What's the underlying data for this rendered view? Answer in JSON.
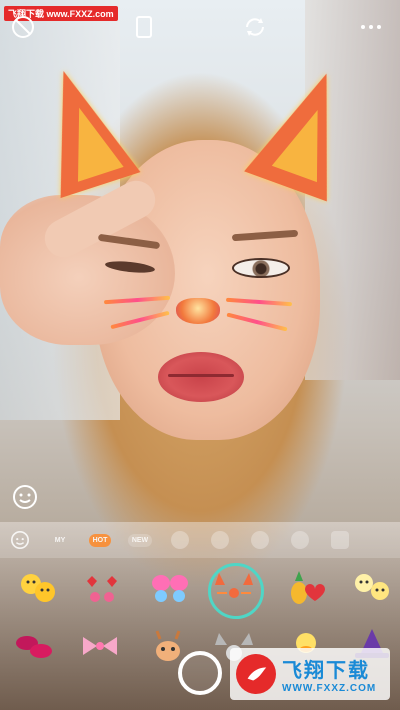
{
  "watermark_top": "飞翔下载 www.FXXZ.com",
  "watermark_bottom": {
    "title": "飞翔下载",
    "url": "WWW.FXXZ.COM"
  },
  "topbar": {
    "icons": [
      "timer-off-icon",
      "aspect-ratio-icon",
      "camera-switch-icon",
      "more-icon"
    ]
  },
  "tabs": [
    {
      "id": "favorites",
      "icon": "face-edit-icon"
    },
    {
      "id": "my",
      "label": "MY"
    },
    {
      "id": "hot",
      "label": "HOT"
    },
    {
      "id": "new",
      "label": "NEW"
    },
    {
      "id": "cat",
      "icon": "cat-face-icon"
    },
    {
      "id": "dog",
      "icon": "dog-face-icon"
    },
    {
      "id": "raccoon",
      "icon": "raccoon-icon"
    },
    {
      "id": "monster",
      "icon": "monster-icon"
    },
    {
      "id": "more",
      "icon": "more-tab-icon"
    }
  ],
  "stickers": [
    "emoji-pair-sticker",
    "red-heart-glasses-sticker",
    "butterfly-sticker",
    "sparkle-cat-sticker",
    "pineapple-heart-sticker",
    "chick-pair-sticker",
    "lips-sticker",
    "sparkle-bow-sticker",
    "deer-sticker",
    "cat-ears-sticker",
    "duck-sticker",
    "witch-hat-sticker"
  ],
  "colors": {
    "selected_ring": "#4fd6c6",
    "hot_badge": "#ff8a2a",
    "watermark_red": "#e52a2a",
    "watermark_blue": "#1a8ad6"
  }
}
